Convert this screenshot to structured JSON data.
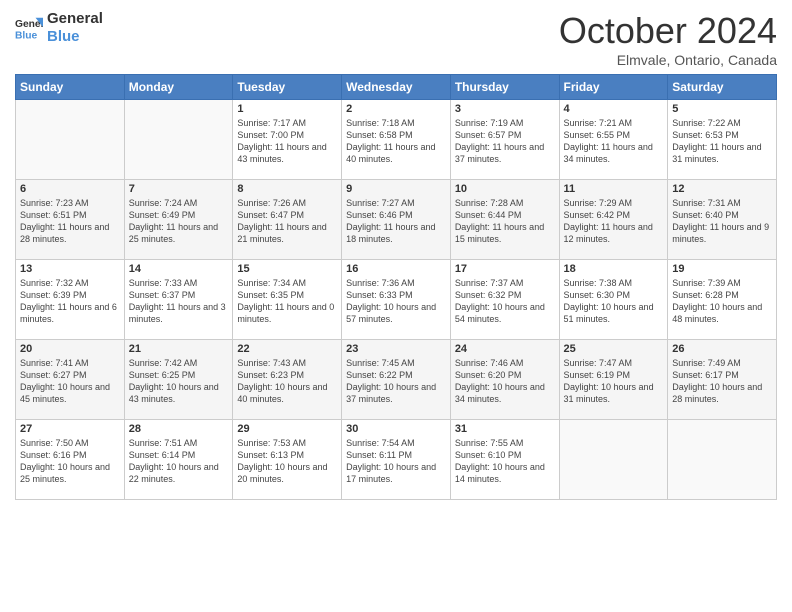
{
  "logo": {
    "line1": "General",
    "line2": "Blue"
  },
  "title": "October 2024",
  "location": "Elmvale, Ontario, Canada",
  "days_of_week": [
    "Sunday",
    "Monday",
    "Tuesday",
    "Wednesday",
    "Thursday",
    "Friday",
    "Saturday"
  ],
  "weeks": [
    [
      {
        "day": "",
        "info": ""
      },
      {
        "day": "",
        "info": ""
      },
      {
        "day": "1",
        "info": "Sunrise: 7:17 AM\nSunset: 7:00 PM\nDaylight: 11 hours and 43 minutes."
      },
      {
        "day": "2",
        "info": "Sunrise: 7:18 AM\nSunset: 6:58 PM\nDaylight: 11 hours and 40 minutes."
      },
      {
        "day": "3",
        "info": "Sunrise: 7:19 AM\nSunset: 6:57 PM\nDaylight: 11 hours and 37 minutes."
      },
      {
        "day": "4",
        "info": "Sunrise: 7:21 AM\nSunset: 6:55 PM\nDaylight: 11 hours and 34 minutes."
      },
      {
        "day": "5",
        "info": "Sunrise: 7:22 AM\nSunset: 6:53 PM\nDaylight: 11 hours and 31 minutes."
      }
    ],
    [
      {
        "day": "6",
        "info": "Sunrise: 7:23 AM\nSunset: 6:51 PM\nDaylight: 11 hours and 28 minutes."
      },
      {
        "day": "7",
        "info": "Sunrise: 7:24 AM\nSunset: 6:49 PM\nDaylight: 11 hours and 25 minutes."
      },
      {
        "day": "8",
        "info": "Sunrise: 7:26 AM\nSunset: 6:47 PM\nDaylight: 11 hours and 21 minutes."
      },
      {
        "day": "9",
        "info": "Sunrise: 7:27 AM\nSunset: 6:46 PM\nDaylight: 11 hours and 18 minutes."
      },
      {
        "day": "10",
        "info": "Sunrise: 7:28 AM\nSunset: 6:44 PM\nDaylight: 11 hours and 15 minutes."
      },
      {
        "day": "11",
        "info": "Sunrise: 7:29 AM\nSunset: 6:42 PM\nDaylight: 11 hours and 12 minutes."
      },
      {
        "day": "12",
        "info": "Sunrise: 7:31 AM\nSunset: 6:40 PM\nDaylight: 11 hours and 9 minutes."
      }
    ],
    [
      {
        "day": "13",
        "info": "Sunrise: 7:32 AM\nSunset: 6:39 PM\nDaylight: 11 hours and 6 minutes."
      },
      {
        "day": "14",
        "info": "Sunrise: 7:33 AM\nSunset: 6:37 PM\nDaylight: 11 hours and 3 minutes."
      },
      {
        "day": "15",
        "info": "Sunrise: 7:34 AM\nSunset: 6:35 PM\nDaylight: 11 hours and 0 minutes."
      },
      {
        "day": "16",
        "info": "Sunrise: 7:36 AM\nSunset: 6:33 PM\nDaylight: 10 hours and 57 minutes."
      },
      {
        "day": "17",
        "info": "Sunrise: 7:37 AM\nSunset: 6:32 PM\nDaylight: 10 hours and 54 minutes."
      },
      {
        "day": "18",
        "info": "Sunrise: 7:38 AM\nSunset: 6:30 PM\nDaylight: 10 hours and 51 minutes."
      },
      {
        "day": "19",
        "info": "Sunrise: 7:39 AM\nSunset: 6:28 PM\nDaylight: 10 hours and 48 minutes."
      }
    ],
    [
      {
        "day": "20",
        "info": "Sunrise: 7:41 AM\nSunset: 6:27 PM\nDaylight: 10 hours and 45 minutes."
      },
      {
        "day": "21",
        "info": "Sunrise: 7:42 AM\nSunset: 6:25 PM\nDaylight: 10 hours and 43 minutes."
      },
      {
        "day": "22",
        "info": "Sunrise: 7:43 AM\nSunset: 6:23 PM\nDaylight: 10 hours and 40 minutes."
      },
      {
        "day": "23",
        "info": "Sunrise: 7:45 AM\nSunset: 6:22 PM\nDaylight: 10 hours and 37 minutes."
      },
      {
        "day": "24",
        "info": "Sunrise: 7:46 AM\nSunset: 6:20 PM\nDaylight: 10 hours and 34 minutes."
      },
      {
        "day": "25",
        "info": "Sunrise: 7:47 AM\nSunset: 6:19 PM\nDaylight: 10 hours and 31 minutes."
      },
      {
        "day": "26",
        "info": "Sunrise: 7:49 AM\nSunset: 6:17 PM\nDaylight: 10 hours and 28 minutes."
      }
    ],
    [
      {
        "day": "27",
        "info": "Sunrise: 7:50 AM\nSunset: 6:16 PM\nDaylight: 10 hours and 25 minutes."
      },
      {
        "day": "28",
        "info": "Sunrise: 7:51 AM\nSunset: 6:14 PM\nDaylight: 10 hours and 22 minutes."
      },
      {
        "day": "29",
        "info": "Sunrise: 7:53 AM\nSunset: 6:13 PM\nDaylight: 10 hours and 20 minutes."
      },
      {
        "day": "30",
        "info": "Sunrise: 7:54 AM\nSunset: 6:11 PM\nDaylight: 10 hours and 17 minutes."
      },
      {
        "day": "31",
        "info": "Sunrise: 7:55 AM\nSunset: 6:10 PM\nDaylight: 10 hours and 14 minutes."
      },
      {
        "day": "",
        "info": ""
      },
      {
        "day": "",
        "info": ""
      }
    ]
  ]
}
